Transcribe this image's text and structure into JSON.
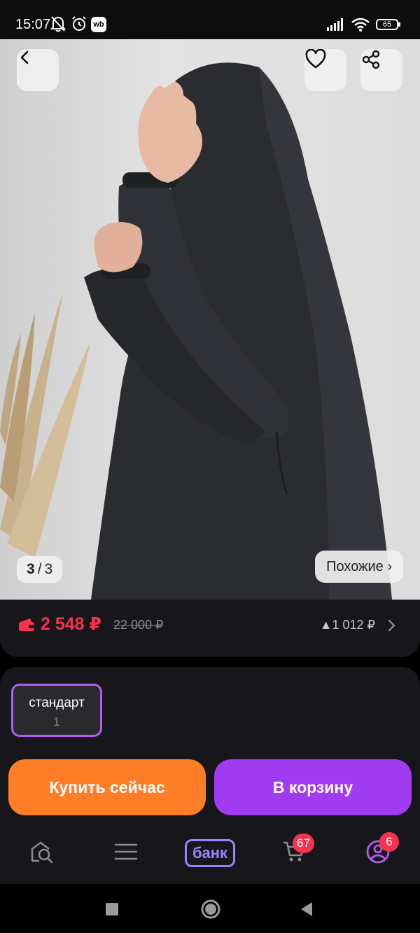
{
  "status": {
    "time": "15:07",
    "wb_badge": "wb",
    "battery": "65"
  },
  "gallery": {
    "current": "3",
    "separator": "/",
    "total": "3",
    "similar_label": "Похожие ›"
  },
  "price": {
    "current": "2 548 ₽",
    "old": "22 000 ₽",
    "delta": "▲1 012 ₽"
  },
  "variant": {
    "name": "стандарт",
    "quantity": "1"
  },
  "actions": {
    "buy_now": "Купить сейчас",
    "add_to_cart": "В корзину"
  },
  "tabbar": {
    "bank_label": "банк",
    "cart_badge": "67",
    "profile_badge": "6"
  },
  "colors": {
    "accent_purple": "#a13bf2",
    "accent_orange": "#ff7d26",
    "price_red": "#f5334f",
    "bank_violet": "#9a82ff"
  },
  "icons": [
    "back-arrow-icon",
    "heart-icon",
    "share-icon",
    "wallet-icon",
    "chevron-right-icon",
    "home-search-icon",
    "menu-icon",
    "cart-icon",
    "profile-icon",
    "nav-square-icon",
    "nav-circle-icon",
    "nav-back-icon"
  ]
}
